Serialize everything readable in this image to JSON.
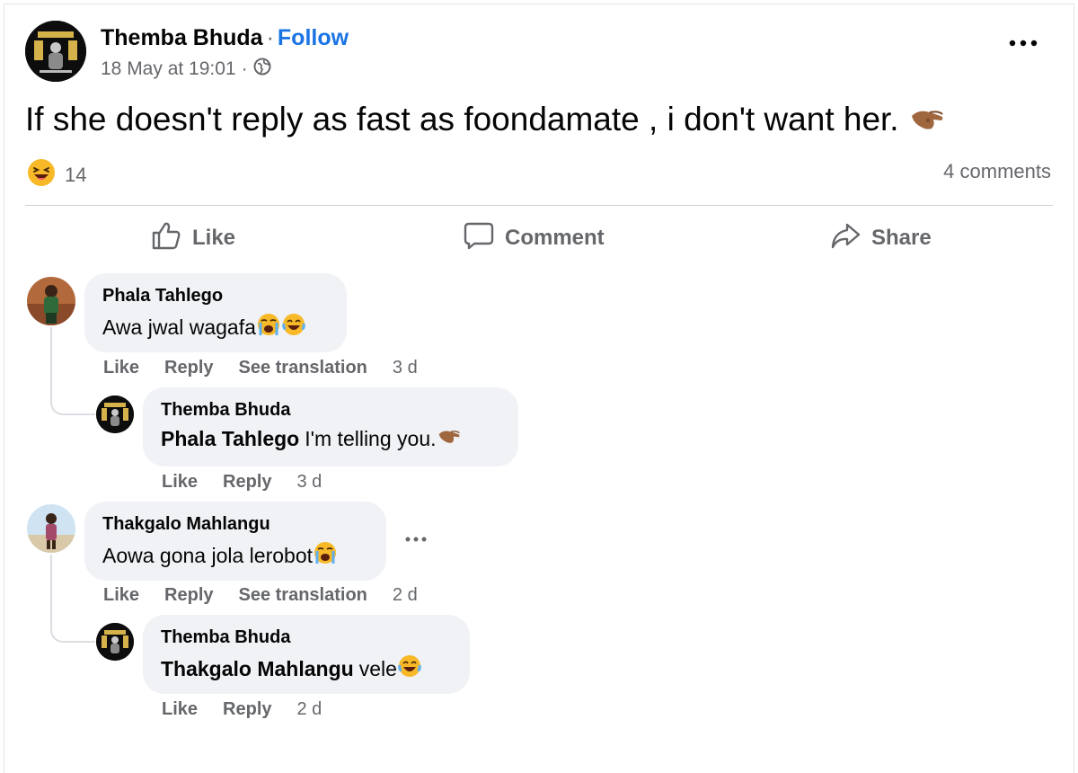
{
  "post": {
    "author": "Themba Bhuda",
    "separator": "·",
    "follow_label": "Follow",
    "date": "18 May at 19:01",
    "date_separator": "·",
    "audience_icon": "globe-icon",
    "text": "If she doesn't reply as fast as foondamate , i don't want her.",
    "text_emoji": "pinching-hand-emoji",
    "reaction_icon": "laughing-face-icon",
    "reaction_count": "14",
    "comments_count": "4 comments"
  },
  "actions": {
    "like": "Like",
    "comment": "Comment",
    "share": "Share"
  },
  "comments": [
    {
      "author": "Phala Tahlego",
      "text": "Awa jwal wagafa",
      "emojis": [
        "loudly-crying-face-emoji",
        "tears-of-joy-emoji"
      ],
      "like": "Like",
      "reply": "Reply",
      "translate": "See translation",
      "time": "3 d",
      "replies": [
        {
          "author": "Themba Bhuda",
          "mention": "Phala Tahlego",
          "text": "I'm telling you.",
          "emojis": [
            "pinching-hand-emoji"
          ],
          "like": "Like",
          "reply": "Reply",
          "time": "3 d"
        }
      ]
    },
    {
      "author": "Thakgalo Mahlangu",
      "text": "Aowa gona jola lerobot",
      "emojis": [
        "loudly-crying-face-emoji"
      ],
      "like": "Like",
      "reply": "Reply",
      "translate": "See translation",
      "time": "2 d",
      "replies": [
        {
          "author": "Themba Bhuda",
          "mention": "Thakgalo Mahlangu",
          "text": "vele",
          "emojis": [
            "tears-of-joy-emoji"
          ],
          "like": "Like",
          "reply": "Reply",
          "time": "2 d"
        }
      ]
    }
  ],
  "colors": {
    "link_blue": "#1b74e4",
    "secondary_text": "#65676b",
    "bubble_bg": "#f0f2f5",
    "divider": "#ced0d4"
  }
}
